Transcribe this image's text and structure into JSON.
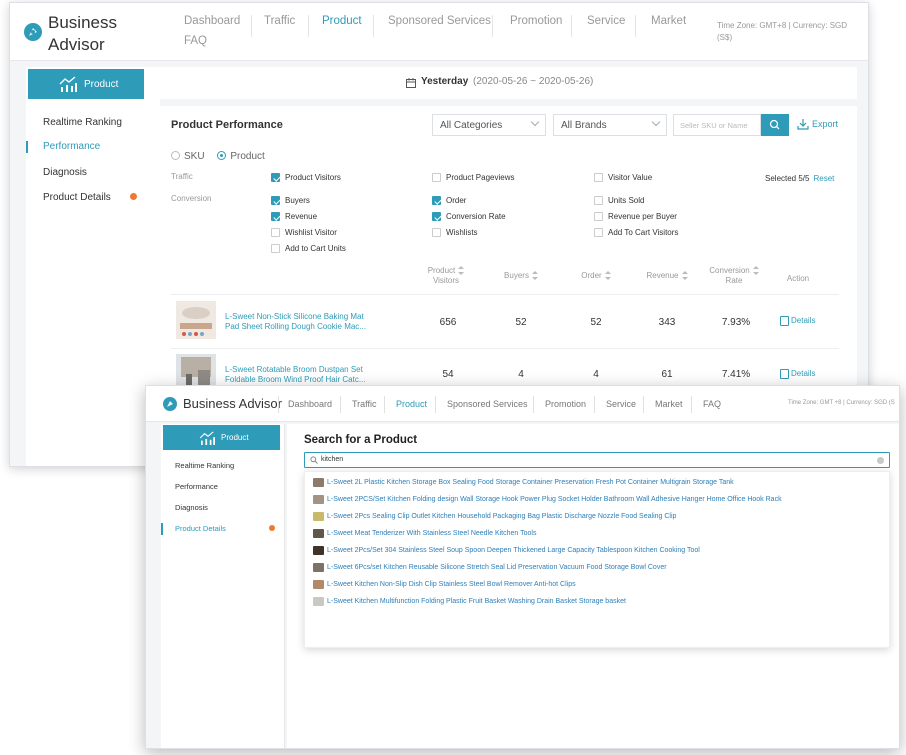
{
  "brand": {
    "name_line1": "Business",
    "name_line2": "Advisor",
    "name": "Business Advisor"
  },
  "colors": {
    "accent": "#2e9bb8",
    "status_dot": "#f07a2c",
    "background": "#f3f5f7"
  },
  "window1": {
    "nav": [
      "Dashboard",
      "Traffic",
      "Product",
      "Sponsored Services",
      "Promotion",
      "Service",
      "Market"
    ],
    "nav_faq": "FAQ",
    "active_nav": "Product",
    "timezone_line1": "Time Zone: GMT+8 | Currency: SGD",
    "timezone_line2": "(S$)",
    "sidebar": {
      "header": "Product",
      "items": [
        "Realtime Ranking",
        "Performance",
        "Diagnosis",
        "Product Details"
      ],
      "active_item": "Performance"
    },
    "date_bar": {
      "label": "Yesterday",
      "range": "(2020-05-26 ~ 2020-05-26)"
    },
    "panel": {
      "title": "Product Performance",
      "category_select": "All Categories",
      "brand_select": "All Brands",
      "search_placeholder": "Seller SKU or Name",
      "export_label": "Export",
      "radio_options": [
        "SKU",
        "Product"
      ],
      "radio_selected": "Product",
      "traffic_label": "Traffic",
      "conversion_label": "Conversion",
      "traffic_metrics": [
        {
          "label": "Product Visitors",
          "checked": true
        },
        {
          "label": "Product Pageviews",
          "checked": false
        },
        {
          "label": "Visitor Value",
          "checked": false
        }
      ],
      "conversion_metrics": [
        {
          "label": "Buyers",
          "checked": true
        },
        {
          "label": "Order",
          "checked": true
        },
        {
          "label": "Units Sold",
          "checked": false
        },
        {
          "label": "Revenue",
          "checked": true
        },
        {
          "label": "Conversion Rate",
          "checked": true
        },
        {
          "label": "Revenue per Buyer",
          "checked": false
        },
        {
          "label": "Wishlist Visitor",
          "checked": false
        },
        {
          "label": "Wishlists",
          "checked": false
        },
        {
          "label": "Add To Cart Visitors",
          "checked": false
        },
        {
          "label": "Add to Cart Units",
          "checked": false
        }
      ],
      "selected_info": "Selected 5/5",
      "reset_label": "Reset",
      "columns": {
        "visitors_1": "Product",
        "visitors_2": "Visitors",
        "buyers": "Buyers",
        "order": "Order",
        "revenue": "Revenue",
        "conv_1": "Conversion",
        "conv_2": "Rate",
        "action": "Action"
      },
      "rows": [
        {
          "name_1": "L-Sweet Non-Stick Silicone Baking Mat",
          "name_2": "Pad Sheet Rolling Dough Cookie Mac...",
          "visitors": "656",
          "buyers": "52",
          "order": "52",
          "revenue": "343",
          "conversion": "7.93%",
          "action": "Details"
        },
        {
          "name_1": "L-Sweet Rotatable Broom Dustpan Set",
          "name_2": "Foldable Broom Wind Proof Hair Catc...",
          "visitors": "54",
          "buyers": "4",
          "order": "4",
          "revenue": "61",
          "conversion": "7.41%",
          "action": "Details"
        }
      ]
    }
  },
  "window2": {
    "nav": [
      "Dashboard",
      "Traffic",
      "Product",
      "Sponsored Services",
      "Promotion",
      "Service",
      "Market",
      "FAQ"
    ],
    "active_nav": "Product",
    "timezone": "Time Zone: GMT +8 | Currency: SGD (S",
    "sidebar": {
      "header": "Product",
      "items": [
        "Realtime Ranking",
        "Performance",
        "Diagnosis",
        "Product Details"
      ],
      "active_item": "Product Details"
    },
    "search": {
      "title": "Search for a Product",
      "query": "kitchen",
      "suggestions": [
        "L-Sweet 2L Plastic Kitchen Storage Box Sealing Food Storage Container Preservation Fresh Pot Container Multigrain Storage Tank",
        "L-Sweet 2PCS/Set Kitchen Folding design Wall Storage Hook Power Plug Socket Holder Bathroom Wall Adhesive Hanger Home Office Hook Rack",
        "L-Sweet 2Pcs Sealing Clip Outlet Kitchen Household Packaging Bag Plastic Discharge Nozzle Food Sealing Clip",
        "L-Sweet Meat Tenderizer With Stainless Steel Needle Kitchen Tools",
        "L-Sweet 2Pcs/Set 304 Stainless Steel Soup Spoon Deepen Thickened Large Capacity Tablespoon Kitchen Cooking Tool",
        "L-Sweet 6Pcs/set Kitchen Reusable Silicone Stretch Seal Lid Preservation Vacuum Food Storage Bowl Cover",
        "L-Sweet Kitchen Non-Slip Dish Clip Stainless Steel Bowl Remover Anti-hot Clips",
        "L-Sweet Kitchen Multifunction Folding Plastic Fruit Basket Washing Drain Basket Storage basket"
      ]
    }
  }
}
